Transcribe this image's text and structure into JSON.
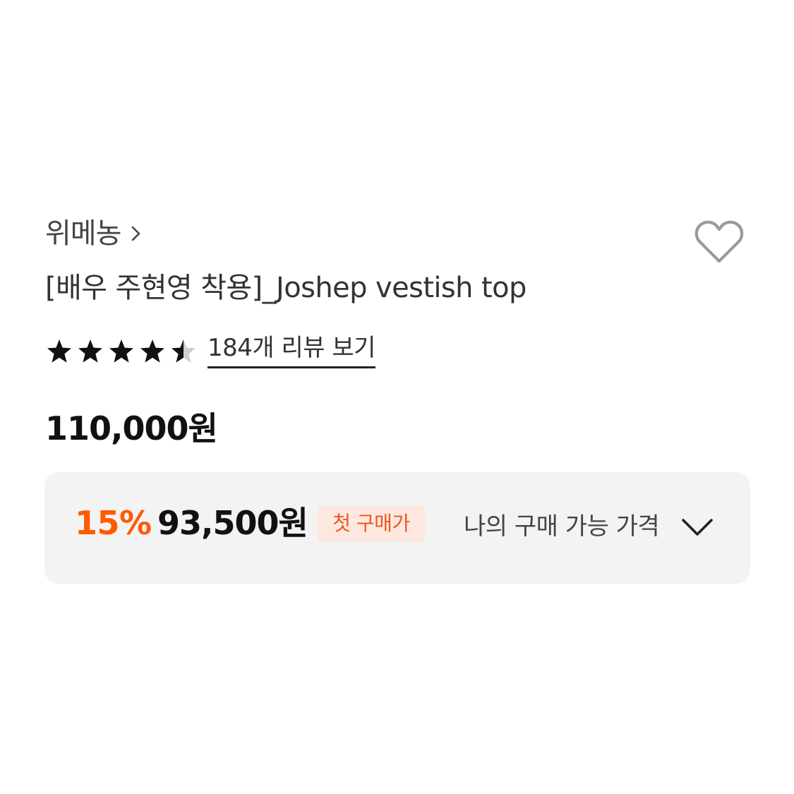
{
  "brand": {
    "name": "위메농",
    "chevron_icon": "chevron-right-icon"
  },
  "wishlist": {
    "icon": "heart-outline-icon",
    "color": "#9a9a9a"
  },
  "product": {
    "title": "[배우 주현영 착용]_Joshep vestish top"
  },
  "rating": {
    "stars": 4.5,
    "max_stars": 5,
    "star_icon": "star-icon",
    "review_link": "184개 리뷰 보기"
  },
  "price": {
    "original": "110,000원"
  },
  "discount_box": {
    "rate": "15%",
    "price": "93,500원",
    "badge": "첫 구매가",
    "label": "나의 구매 가능 가격",
    "expand_icon": "chevron-down-icon",
    "accent_color": "#ff5a00",
    "badge_bg": "#fde8e0"
  }
}
